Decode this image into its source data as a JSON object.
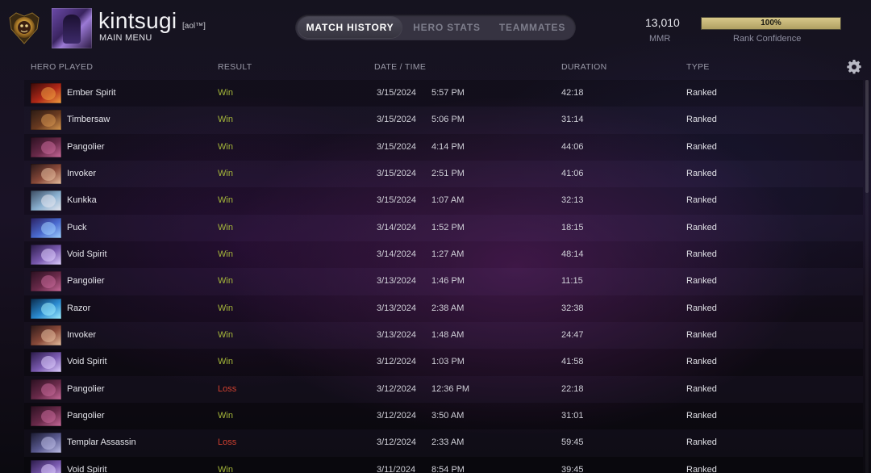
{
  "header": {
    "username": "kintsugi",
    "user_tag": "[aol™]",
    "main_menu": "MAIN MENU",
    "tabs": [
      {
        "label": "MATCH HISTORY",
        "active": true
      },
      {
        "label": "HERO STATS",
        "active": false
      },
      {
        "label": "TEAMMATES",
        "active": false
      }
    ],
    "mmr_value": "13,010",
    "mmr_label": "MMR",
    "rank_confidence_percent": 100,
    "rank_confidence_text": "100%",
    "rank_confidence_label": "Rank Confidence"
  },
  "columns": {
    "hero": "Hero Played",
    "result": "Result",
    "datetime": "Date / Time",
    "duration": "Duration",
    "type": "Type"
  },
  "colors": {
    "win": "#a6b83a",
    "loss": "#d04030",
    "confidence": "#c9b878"
  },
  "matches": [
    {
      "hero": "Ember Spirit",
      "result": "Win",
      "date": "3/15/2024",
      "time": "5:57 PM",
      "duration": "42:18",
      "type": "Ranked",
      "icon": "ember-spirit-portrait"
    },
    {
      "hero": "Timbersaw",
      "result": "Win",
      "date": "3/15/2024",
      "time": "5:06 PM",
      "duration": "31:14",
      "type": "Ranked",
      "icon": "timbersaw-portrait"
    },
    {
      "hero": "Pangolier",
      "result": "Win",
      "date": "3/15/2024",
      "time": "4:14 PM",
      "duration": "44:06",
      "type": "Ranked",
      "icon": "pangolier-portrait"
    },
    {
      "hero": "Invoker",
      "result": "Win",
      "date": "3/15/2024",
      "time": "2:51 PM",
      "duration": "41:06",
      "type": "Ranked",
      "icon": "invoker-portrait"
    },
    {
      "hero": "Kunkka",
      "result": "Win",
      "date": "3/15/2024",
      "time": "1:07 AM",
      "duration": "32:13",
      "type": "Ranked",
      "icon": "kunkka-portrait"
    },
    {
      "hero": "Puck",
      "result": "Win",
      "date": "3/14/2024",
      "time": "1:52 PM",
      "duration": "18:15",
      "type": "Ranked",
      "icon": "puck-portrait"
    },
    {
      "hero": "Void Spirit",
      "result": "Win",
      "date": "3/14/2024",
      "time": "1:27 AM",
      "duration": "48:14",
      "type": "Ranked",
      "icon": "void-spirit-portrait"
    },
    {
      "hero": "Pangolier",
      "result": "Win",
      "date": "3/13/2024",
      "time": "1:46 PM",
      "duration": "11:15",
      "type": "Ranked",
      "icon": "pangolier-portrait"
    },
    {
      "hero": "Razor",
      "result": "Win",
      "date": "3/13/2024",
      "time": "2:38 AM",
      "duration": "32:38",
      "type": "Ranked",
      "icon": "razor-portrait"
    },
    {
      "hero": "Invoker",
      "result": "Win",
      "date": "3/13/2024",
      "time": "1:48 AM",
      "duration": "24:47",
      "type": "Ranked",
      "icon": "invoker-portrait"
    },
    {
      "hero": "Void Spirit",
      "result": "Win",
      "date": "3/12/2024",
      "time": "1:03 PM",
      "duration": "41:58",
      "type": "Ranked",
      "icon": "void-spirit-portrait"
    },
    {
      "hero": "Pangolier",
      "result": "Loss",
      "date": "3/12/2024",
      "time": "12:36 PM",
      "duration": "22:18",
      "type": "Ranked",
      "icon": "pangolier-portrait"
    },
    {
      "hero": "Pangolier",
      "result": "Win",
      "date": "3/12/2024",
      "time": "3:50 AM",
      "duration": "31:01",
      "type": "Ranked",
      "icon": "pangolier-portrait"
    },
    {
      "hero": "Templar Assassin",
      "result": "Loss",
      "date": "3/12/2024",
      "time": "2:33 AM",
      "duration": "59:45",
      "type": "Ranked",
      "icon": "templar-assassin-portrait"
    },
    {
      "hero": "Void Spirit",
      "result": "Win",
      "date": "3/11/2024",
      "time": "8:54 PM",
      "duration": "39:45",
      "type": "Ranked",
      "icon": "void-spirit-portrait"
    }
  ]
}
